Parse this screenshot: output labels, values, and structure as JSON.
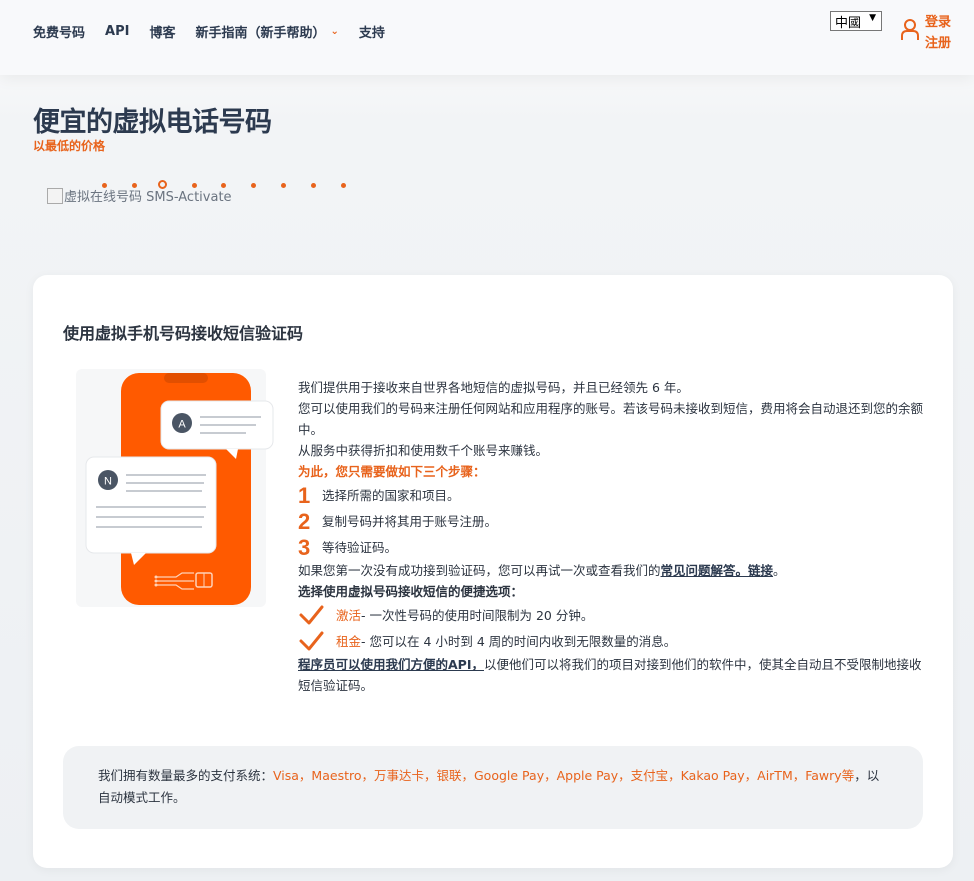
{
  "nav": {
    "items": [
      {
        "label": "免费号码"
      },
      {
        "label": "API"
      },
      {
        "label": "博客"
      },
      {
        "label": "新手指南（新手帮助）"
      },
      {
        "label": "支持"
      }
    ],
    "dropdown_caret": "⌄"
  },
  "language": {
    "selected": "中國"
  },
  "auth": {
    "login": "登录",
    "register": "注册"
  },
  "hero": {
    "title": "便宜的虚拟电话号码",
    "subtitle": "以最低的价格",
    "image_alt": "虚拟在线号码 SMS-Activate"
  },
  "card": {
    "title": "使用虚拟手机号码接收短信验证码",
    "intro": [
      "我们提供用于接收来自世界各地短信的虚拟号码，并且已经领先 6 年。",
      "您可以使用我们的号码来注册任何网站和应用程序的账号。若该号码未接收到短信，费用将会自动退还到您的余额中。",
      "从服务中获得折扣和使用数千个账号来赚钱。"
    ],
    "steps_heading": "为此，您只需要做如下三个步骤：",
    "steps": [
      {
        "num": "1",
        "text": "选择所需的国家和项目。"
      },
      {
        "num": "2",
        "text": "复制号码并将其用于账号注册。"
      },
      {
        "num": "3",
        "text": "等待验证码。"
      }
    ],
    "retry_text": "如果您第一次没有成功接到验证码，您可以再试一次或查看我们的",
    "faq_link": "常见问题解答。链接",
    "retry_end": "。",
    "options_heading": "选择使用虚拟号码接收短信的便捷选项：",
    "options": [
      {
        "name": "激活",
        "desc": " - 一次性号码的使用时间限制为 20 分钟。"
      },
      {
        "name": "租金",
        "desc": " - 您可以在 4 小时到 4 周的时间内收到无限数量的消息。"
      }
    ],
    "api_link": "程序员可以使用我们方便的API，",
    "api_text": "以便他们可以将我们的项目对接到他们的软件中，使其全自动且不受限制地接收短信验证码。",
    "bubble_a": "A",
    "bubble_n": "N"
  },
  "payments": {
    "prefix": "我们拥有数量最多的支付系统：",
    "methods": "Visa，Maestro，万事达卡，银联，Google Pay，Apple Pay，支付宝，Kakao Pay，AirTM，Fawry等",
    "suffix": "，以自动模式工作。"
  },
  "colors": {
    "accent": "#e8631c",
    "text": "#2c3a4f",
    "phone": "#ff5a00"
  }
}
